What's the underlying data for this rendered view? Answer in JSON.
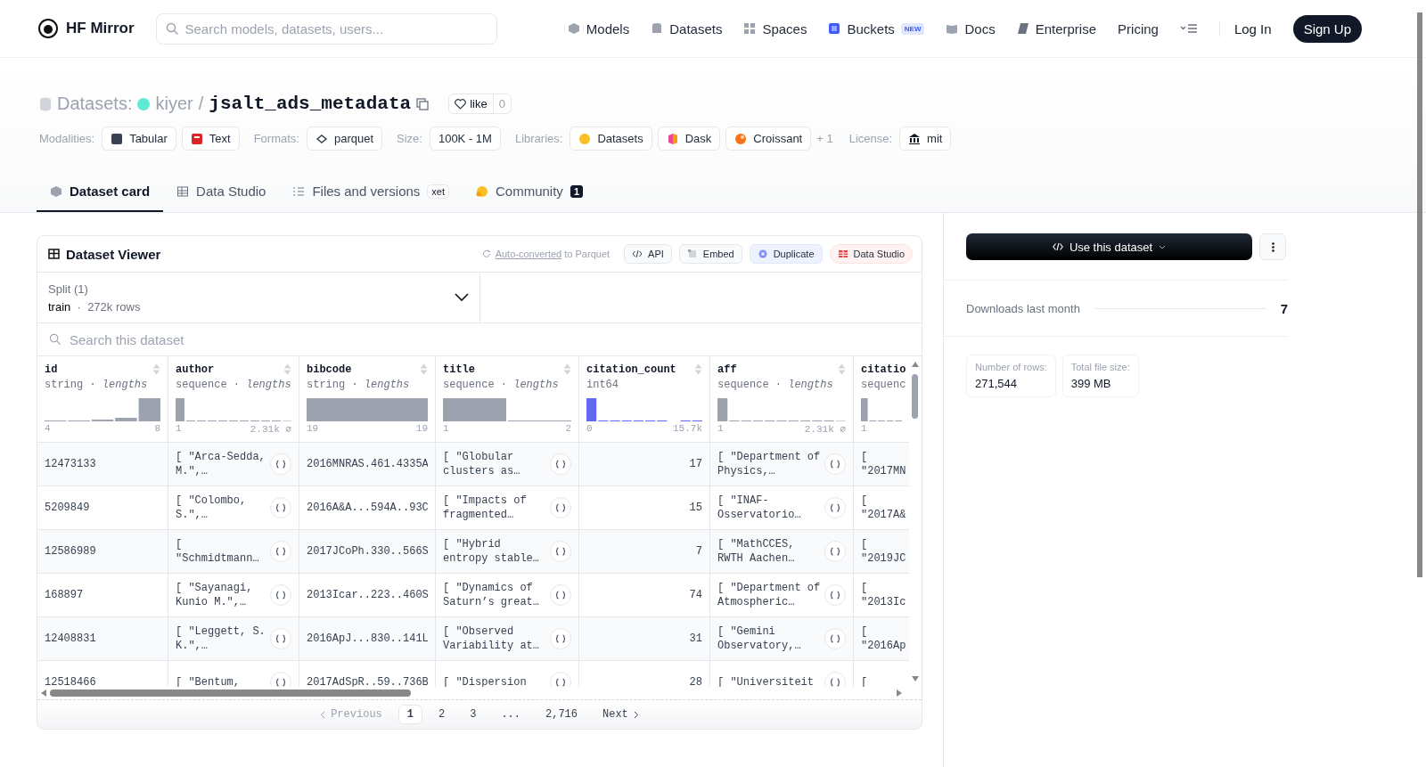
{
  "header": {
    "logo_text": "HF Mirror",
    "search": {
      "placeholder": "Search models, datasets, users..."
    },
    "nav": [
      {
        "label": "Models"
      },
      {
        "label": "Datasets"
      },
      {
        "label": "Spaces"
      },
      {
        "label": "Buckets",
        "badge": "NEW"
      },
      {
        "label": "Docs"
      },
      {
        "label": "Enterprise"
      },
      {
        "label": "Pricing"
      }
    ],
    "login": "Log In",
    "signup": "Sign Up"
  },
  "repo": {
    "type_label": "Datasets:",
    "owner": "kiyer",
    "separator": "/",
    "name": "jsalt_ads_metadata",
    "like": {
      "label": "like",
      "count": "0"
    }
  },
  "tag_groups": [
    {
      "label": "Modalities:",
      "items": [
        "Tabular",
        "Text"
      ]
    },
    {
      "label": "Formats:",
      "items": [
        "parquet"
      ]
    },
    {
      "label": "Size:",
      "items": [
        "100K - 1M"
      ]
    },
    {
      "label": "Libraries:",
      "items": [
        "Datasets",
        "Dask",
        "Croissant"
      ],
      "more": "+ 1"
    },
    {
      "label": "License:",
      "items": [
        "mit"
      ]
    }
  ],
  "tabs": [
    {
      "label": "Dataset card",
      "selected": true
    },
    {
      "label": "Data Studio",
      "selected": false
    },
    {
      "label": "Files and versions",
      "selected": false,
      "badge": {
        "text": "xet",
        "kind": "storage"
      }
    },
    {
      "label": "Community",
      "selected": false,
      "badge": {
        "text": "1",
        "kind": "count"
      }
    }
  ],
  "viewer": {
    "title": "Dataset Viewer",
    "conversion": {
      "link": "Auto-converted",
      "rest": "to Parquet"
    },
    "actions": [
      {
        "label": "API",
        "kind": "plain"
      },
      {
        "label": "Embed",
        "kind": "plain"
      },
      {
        "label": "Duplicate",
        "kind": "accent"
      },
      {
        "label": "Data Studio",
        "kind": "danger"
      }
    ],
    "split": {
      "label": "Split (1)",
      "value": "train",
      "separator": "·",
      "rows": "272k rows"
    },
    "search": {
      "placeholder": "Search this dataset"
    },
    "columns": [
      {
        "name": "id",
        "type": "string",
        "separator": "·",
        "stat": "lengths",
        "min": "4",
        "max": "8",
        "kind": "string"
      },
      {
        "name": "author",
        "type": "sequence",
        "separator": "·",
        "stat": "lengths",
        "min": "1",
        "max": "2.31k",
        "null": "∅",
        "kind": "sequence"
      },
      {
        "name": "bibcode",
        "type": "string",
        "separator": "·",
        "stat": "lengths",
        "min": "19",
        "max": "19",
        "kind": "string"
      },
      {
        "name": "title",
        "type": "sequence",
        "separator": "·",
        "stat": "lengths",
        "min": "1",
        "max": "2",
        "kind": "sequence"
      },
      {
        "name": "citation_count",
        "type": "int64",
        "min": "0",
        "max": "15.7k",
        "kind": "number"
      },
      {
        "name": "aff",
        "type": "sequence",
        "separator": "·",
        "stat": "lengths",
        "min": "1",
        "max": "2.31k",
        "null": "∅",
        "kind": "sequence"
      },
      {
        "name": "citatio",
        "type": "sequenc",
        "min": "1",
        "kind": "sequence"
      }
    ],
    "rows": [
      [
        "12473133",
        "[ \"Arca-Sedda, M.\",…",
        "2016MNRAS.461.4335A",
        "[ \"Globular clusters as…",
        "17",
        "[ \"Department of Physics,…",
        "[ \"2017MN"
      ],
      [
        "5209849",
        "[ \"Colombo, S.\",…",
        "2016A&A...594A..93C",
        "[ \"Impacts of fragmented…",
        "15",
        "[ \"INAF-Osservatorio…",
        "[ \"2017A&"
      ],
      [
        "12586989",
        "[ \"Schmidtmann…",
        "2017JCoPh.330..566S",
        "[ \"Hybrid entropy stable…",
        "7",
        "[ \"MathCCES, RWTH Aachen…",
        "[ \"2019JC"
      ],
      [
        "168897",
        "[ \"Sayanagi, Kunio M.\",…",
        "2013Icar..223..460S",
        "[ \"Dynamics of Saturn’s great…",
        "74",
        "[ \"Department of Atmospheric…",
        "[ \"2013Ic"
      ],
      [
        "12408831",
        "[ \"Leggett, S. K.\",…",
        "2016ApJ...830..141L",
        "[ \"Observed Variability at…",
        "31",
        "[ \"Gemini Observatory,…",
        "[ \"2016Ap"
      ],
      [
        "12518466",
        "[ \"Bentum,",
        "2017AdSpR..59..736B",
        "[ \"Dispersion",
        "28",
        "[ \"Universiteit",
        "["
      ]
    ],
    "pagination": [
      {
        "label": "Previous",
        "kind": "prev",
        "disabled": true
      },
      {
        "label": "1",
        "kind": "page",
        "selected": true
      },
      {
        "label": "2",
        "kind": "page",
        "selected": false
      },
      {
        "label": "3",
        "kind": "page",
        "selected": false
      },
      {
        "label": "...",
        "kind": "gap"
      },
      {
        "label": "2,716",
        "kind": "page",
        "selected": false
      },
      {
        "label": "Next",
        "kind": "next",
        "disabled": false
      }
    ]
  },
  "sidebar": {
    "use_button": "Use this dataset",
    "downloads": {
      "label": "Downloads last month",
      "value": "7"
    },
    "stats": [
      {
        "label": "Number of rows:",
        "value": "271,544"
      },
      {
        "label": "Total file size:",
        "value": "399 MB"
      }
    ]
  }
}
